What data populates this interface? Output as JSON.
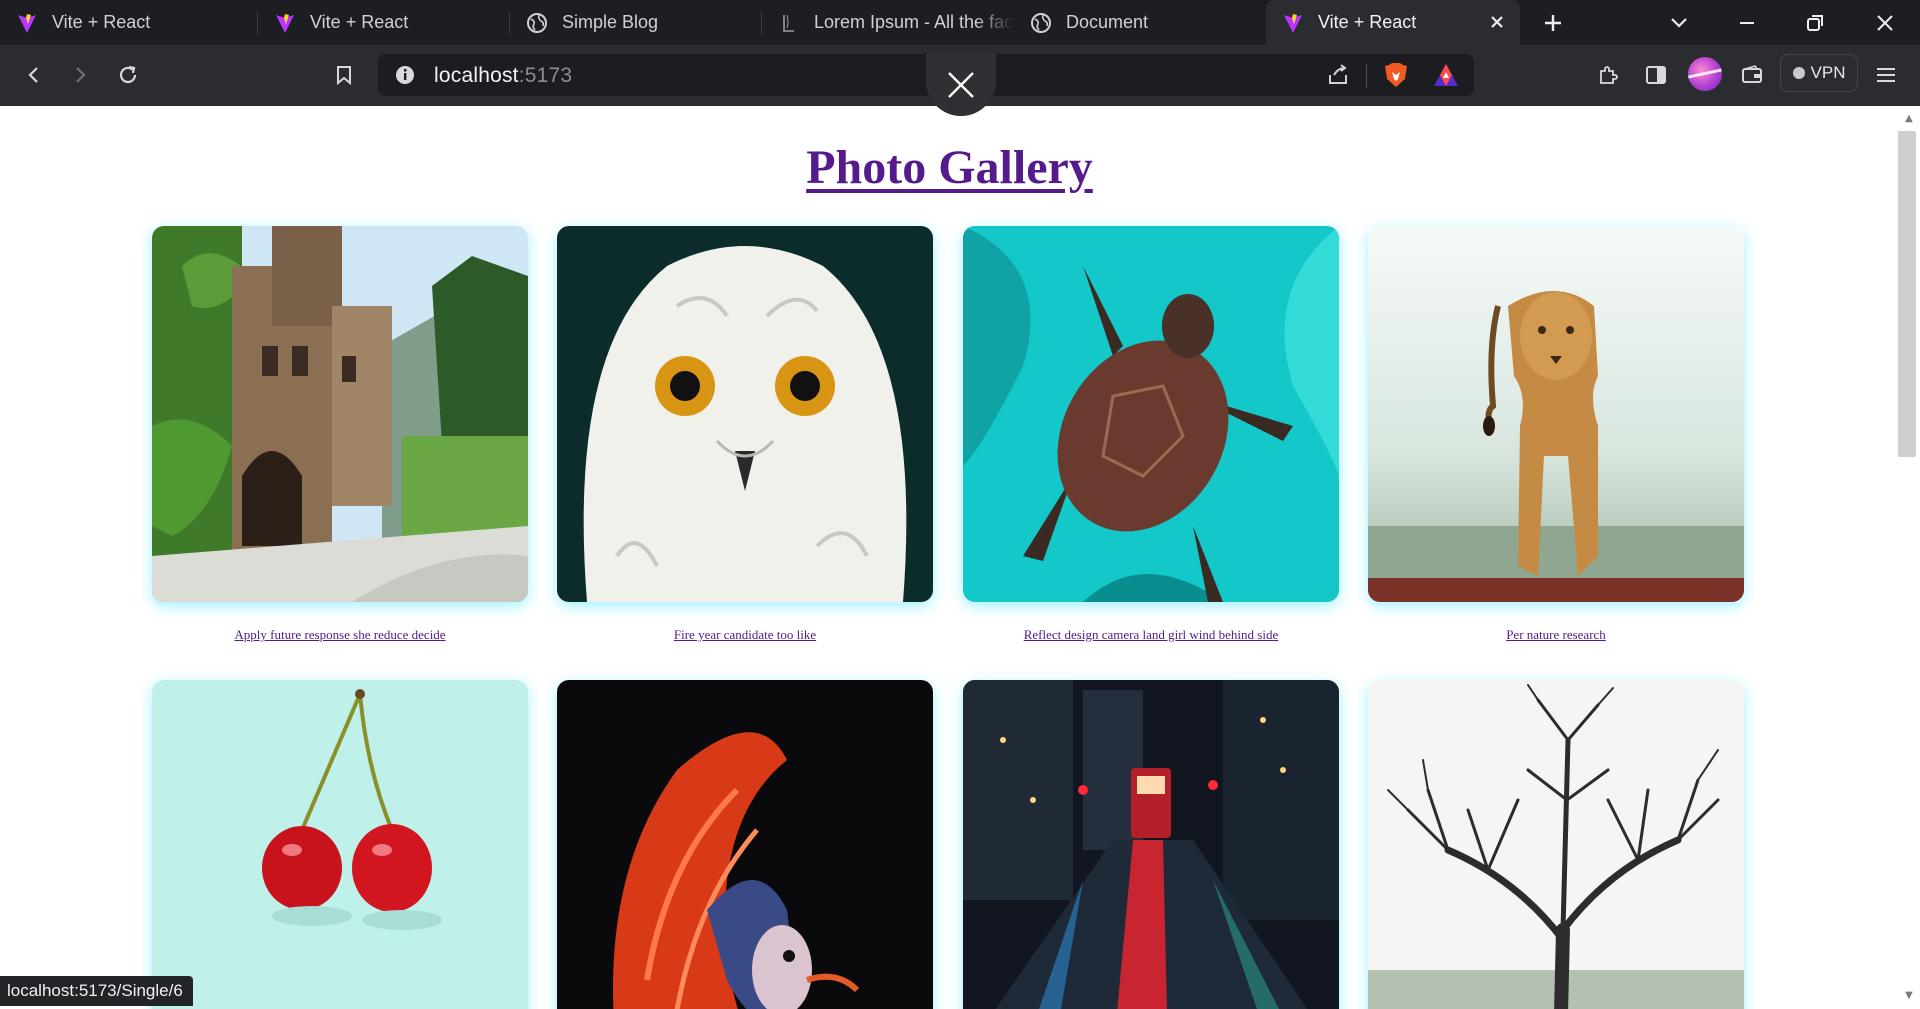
{
  "browser": {
    "tabs": [
      {
        "title": "Vite + React",
        "icon": "vite-icon",
        "active": false
      },
      {
        "title": "Vite + React",
        "icon": "vite-icon",
        "active": false
      },
      {
        "title": "Simple Blog",
        "icon": "globe-icon",
        "active": false
      },
      {
        "title": "Lorem Ipsum - All the facts",
        "icon": "lipsum-icon",
        "active": false
      },
      {
        "title": "Document",
        "icon": "globe-icon",
        "active": false
      },
      {
        "title": "Vite + React",
        "icon": "vite-icon",
        "active": true
      }
    ],
    "url_host": "localhost",
    "url_port": ":5173",
    "vpn_label": "VPN",
    "status_url": "localhost:5173/Single/6"
  },
  "page": {
    "title": "Photo Gallery",
    "photos": [
      {
        "caption": "Apply future response she reduce decide",
        "subject": "castle"
      },
      {
        "caption": "Fire year candidate too like",
        "subject": "owl"
      },
      {
        "caption": "Reflect design camera land girl wind behind side",
        "subject": "sea-turtle"
      },
      {
        "caption": "Per nature research",
        "subject": "lioness"
      },
      {
        "caption": "",
        "subject": "cherries"
      },
      {
        "caption": "",
        "subject": "betta-fish"
      },
      {
        "caption": "",
        "subject": "night-street"
      },
      {
        "caption": "",
        "subject": "bare-tree"
      }
    ]
  },
  "colors": {
    "link": "#551a8b",
    "tab_strip": "#1d1e22",
    "toolbar": "#2b2c30",
    "card_glow": "#50e6ff"
  }
}
